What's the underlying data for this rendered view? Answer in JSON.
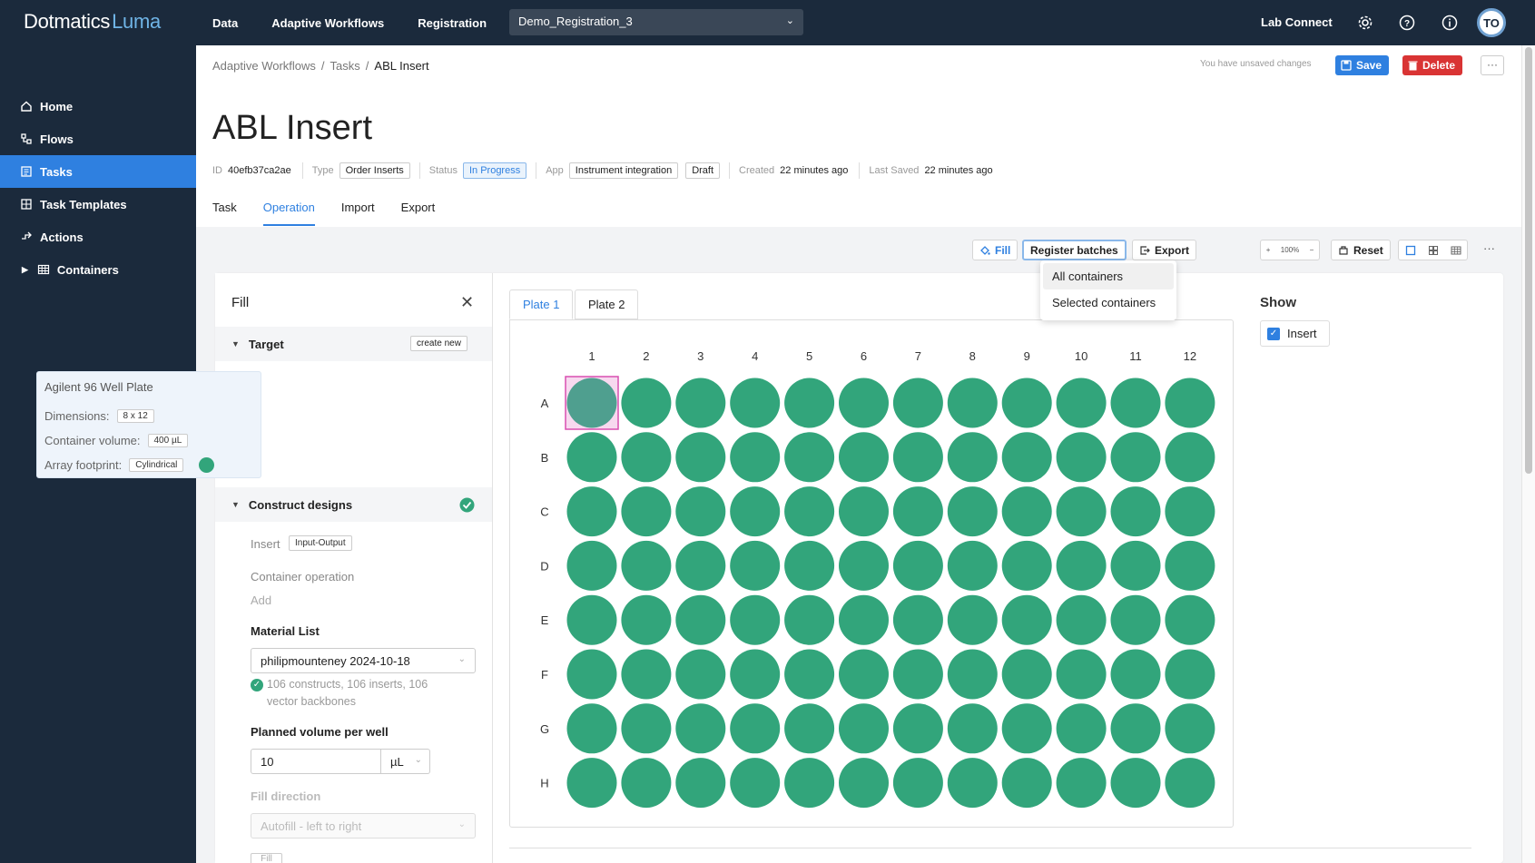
{
  "app": {
    "brand_main": "Dotmatics",
    "brand_accent": "Luma",
    "nav": [
      "Data",
      "Adaptive Workflows",
      "Registration"
    ],
    "project": "Demo_Registration_3",
    "lab_connect": "Lab Connect",
    "avatar_initials": "TO",
    "colors": {
      "topbar": "#1b2a3c",
      "accent": "#2f80e0",
      "danger": "#d93434",
      "well": "#32a57b",
      "well_selected": "#4f9f8f"
    }
  },
  "sidebar": {
    "items": [
      {
        "label": "Home",
        "icon": "home-icon"
      },
      {
        "label": "Flows",
        "icon": "flows-icon"
      },
      {
        "label": "Tasks",
        "icon": "tasks-icon",
        "active": true
      },
      {
        "label": "Task Templates",
        "icon": "templates-icon"
      },
      {
        "label": "Actions",
        "icon": "actions-icon"
      },
      {
        "label": "Containers",
        "icon": "grid-icon"
      }
    ]
  },
  "header": {
    "breadcrumb": [
      "Adaptive Workflows",
      "Tasks",
      "ABL Insert"
    ],
    "unsaved": "You have unsaved changes",
    "save": "Save",
    "delete": "Delete",
    "more": "···",
    "title": "ABL Insert",
    "meta": {
      "id_label": "ID",
      "id_value": "40efb37ca2ae",
      "type_label": "Type",
      "type_value": "Order Inserts",
      "status_label": "Status",
      "status_value": "In Progress",
      "app_label": "App",
      "app_value": "Instrument integration",
      "app_draft": "Draft",
      "created_label": "Created",
      "created_value": "22 minutes ago",
      "saved_label": "Last Saved",
      "saved_value": "22 minutes ago"
    },
    "tabs": [
      "Task",
      "Operation",
      "Import",
      "Export"
    ],
    "active_tab": "Operation"
  },
  "toolbar": {
    "fill": "Fill",
    "register": "Register batches",
    "export": "Export",
    "zoom_plus": "+",
    "zoom": "100%",
    "zoom_minus": "−",
    "reset": "Reset",
    "more": "···",
    "dropdown": [
      "All containers",
      "Selected containers"
    ]
  },
  "fill_panel": {
    "title": "Fill",
    "target": {
      "heading": "Target",
      "create_new": "create new",
      "plate_name": "Agilent 96 Well Plate",
      "dimensions_label": "Dimensions:",
      "dimensions": "8 x 12",
      "volume_label": "Container volume:",
      "volume": "400 µL",
      "footprint_label": "Array footprint:",
      "footprint": "Cylindrical"
    },
    "construct": {
      "heading": "Construct designs",
      "insert_label": "Insert",
      "insert_tag": "Input-Output",
      "container_op": "Container operation",
      "add": "Add"
    },
    "material_list_label": "Material List",
    "material_list_value": "philipmounteney 2024-10-18",
    "material_summary": "106 constructs, 106 inserts, 106 vector backbones",
    "planned_volume_label": "Planned volume per well",
    "planned_volume": "10",
    "planned_unit": "µL",
    "fill_direction_label": "Fill direction",
    "fill_direction": "Autofill - left to right",
    "fill_button": "Fill"
  },
  "plate": {
    "tabs": [
      "Plate 1",
      "Plate 2"
    ],
    "active": "Plate 1",
    "columns": [
      "1",
      "2",
      "3",
      "4",
      "5",
      "6",
      "7",
      "8",
      "9",
      "10",
      "11",
      "12"
    ],
    "rows": [
      "A",
      "B",
      "C",
      "D",
      "E",
      "F",
      "G",
      "H"
    ],
    "selected_well": "A1"
  },
  "show": {
    "title": "Show",
    "insert": "Insert"
  }
}
